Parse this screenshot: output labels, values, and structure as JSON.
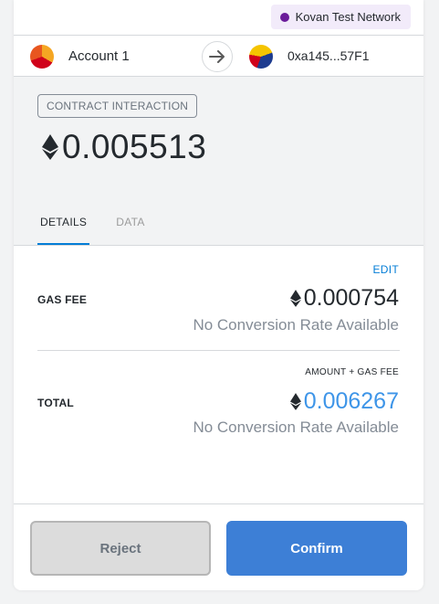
{
  "network": {
    "label": "Kovan Test Network",
    "dot_color": "#6a1b9a"
  },
  "sender": {
    "name": "Account 1",
    "avatar": "account-identicon"
  },
  "recipient": {
    "address": "0xa145...57F1",
    "avatar": "account-identicon"
  },
  "summary": {
    "action": "CONTRACT INTERACTION",
    "amount": "0.005513",
    "currency_icon": "eth-icon"
  },
  "tabs": [
    {
      "label": "DETAILS",
      "active": true
    },
    {
      "label": "DATA",
      "active": false
    }
  ],
  "details": {
    "edit_label": "EDIT",
    "gas_fee": {
      "label": "GAS FEE",
      "value": "0.000754",
      "conversion": "No Conversion Rate Available"
    },
    "total": {
      "subheader": "AMOUNT + GAS FEE",
      "label": "TOTAL",
      "value": "0.006267",
      "conversion": "No Conversion Rate Available",
      "value_color": "#3e95e8"
    }
  },
  "footer": {
    "reject_label": "Reject",
    "confirm_label": "Confirm"
  }
}
